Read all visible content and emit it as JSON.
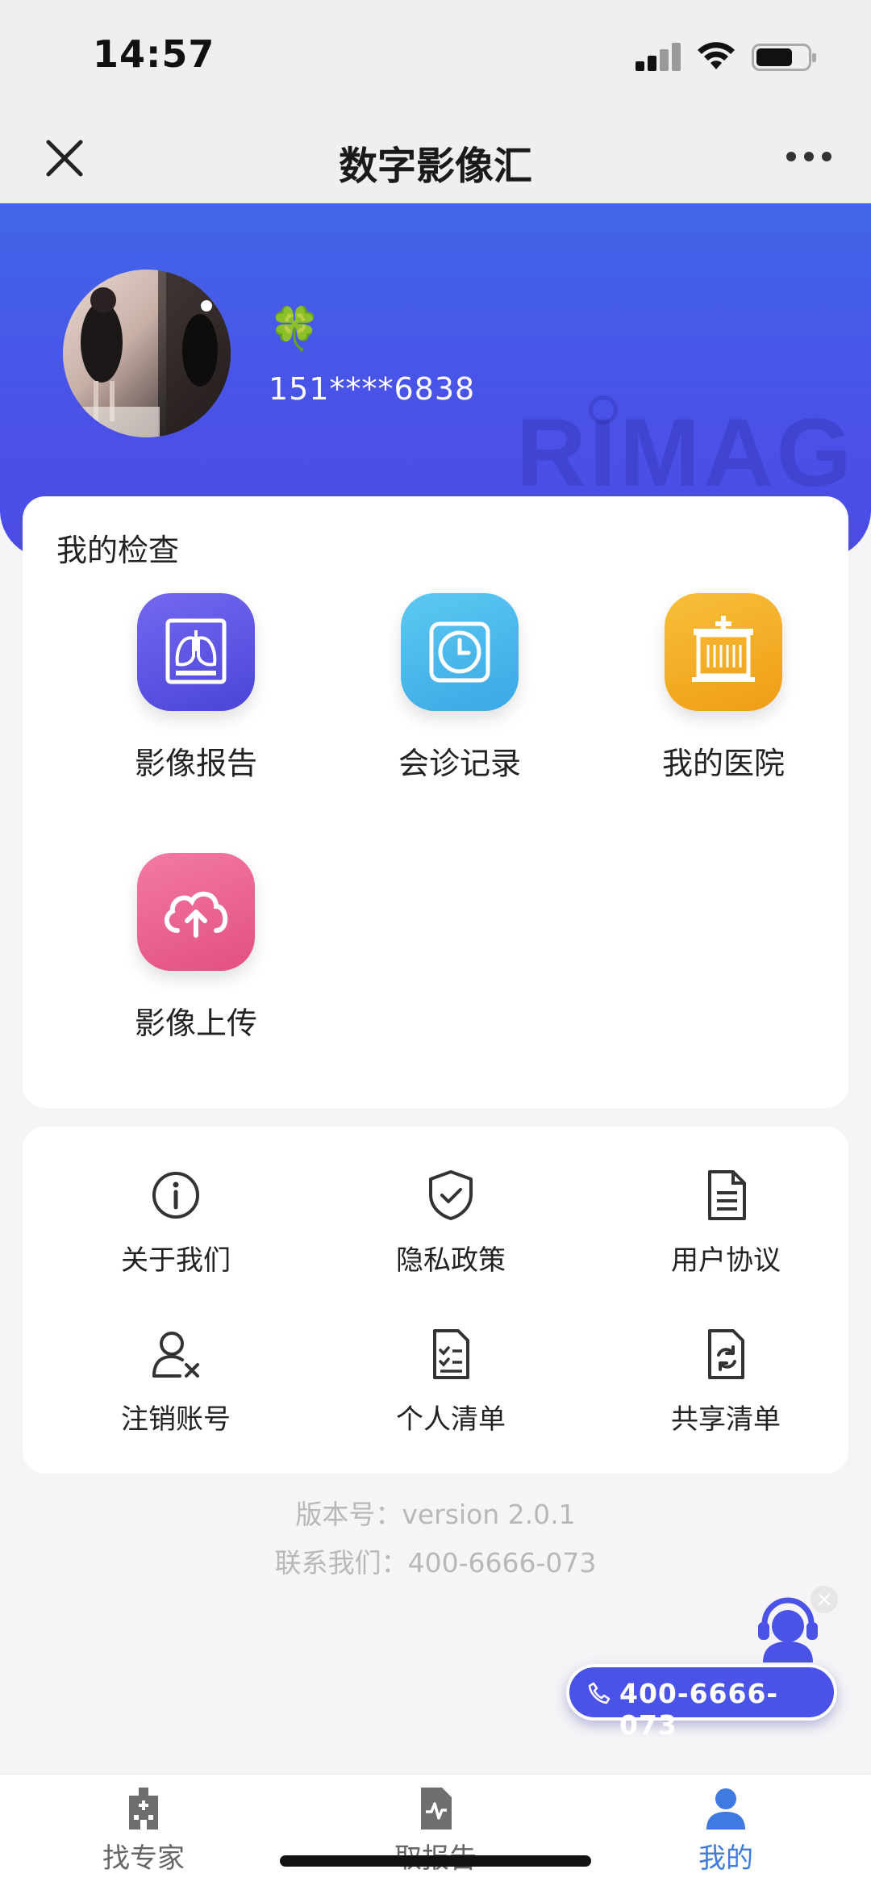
{
  "status_bar": {
    "time": "14:57"
  },
  "nav": {
    "title": "数字影像汇"
  },
  "profile": {
    "emoji": "🍀",
    "phone": "151****6838",
    "watermark": "RIMAG"
  },
  "exams": {
    "title": "我的检查",
    "items": [
      {
        "label": "影像报告",
        "icon": "lung-xray-icon",
        "color": "#5a55e0"
      },
      {
        "label": "会诊记录",
        "icon": "clock-icon",
        "color": "#48b9ec"
      },
      {
        "label": "我的医院",
        "icon": "hospital-icon",
        "color": "#f3a51d"
      },
      {
        "label": "影像上传",
        "icon": "cloud-upload-icon",
        "color": "#e8618f"
      }
    ]
  },
  "settings": {
    "items": [
      {
        "label": "关于我们",
        "icon": "info-icon"
      },
      {
        "label": "隐私政策",
        "icon": "shield-check-icon"
      },
      {
        "label": "用户协议",
        "icon": "document-icon"
      },
      {
        "label": "注销账号",
        "icon": "user-remove-icon"
      },
      {
        "label": "个人清单",
        "icon": "checklist-icon"
      },
      {
        "label": "共享清单",
        "icon": "share-document-icon"
      }
    ]
  },
  "footer": {
    "version": "版本号：version 2.0.1",
    "contact": "联系我们：400-6666-073"
  },
  "hotline": {
    "label": "400-6666-073"
  },
  "tabs": [
    {
      "label": "找专家",
      "icon": "hospital-building-icon",
      "active": false
    },
    {
      "label": "取报告",
      "icon": "report-icon",
      "active": false
    },
    {
      "label": "我的",
      "icon": "user-icon",
      "active": true
    }
  ]
}
